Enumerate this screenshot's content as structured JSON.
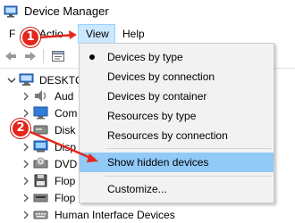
{
  "window": {
    "title": "Device Manager"
  },
  "menubar": {
    "file": "F",
    "action": "Actio",
    "view": "View",
    "help": "Help"
  },
  "tree": {
    "root": "DESKTC",
    "items": [
      {
        "label": "Aud",
        "icon": "speaker-icon"
      },
      {
        "label": "Com",
        "icon": "monitor-icon"
      },
      {
        "label": "Disk",
        "icon": "disk-drive-icon"
      },
      {
        "label": "Disp",
        "icon": "display-adapter-icon"
      },
      {
        "label": "DVD",
        "icon": "dvd-drive-icon"
      },
      {
        "label": "Flop",
        "icon": "floppy-controller-icon"
      },
      {
        "label": "Flop",
        "icon": "floppy-drive-icon"
      },
      {
        "label": "Human Interface Devices",
        "icon": "hid-icon"
      }
    ]
  },
  "view_menu": {
    "items": [
      {
        "label": "Devices by type",
        "selected": true
      },
      {
        "label": "Devices by connection",
        "selected": false
      },
      {
        "label": "Devices by container",
        "selected": false
      },
      {
        "label": "Resources by type",
        "selected": false
      },
      {
        "label": "Resources by connection",
        "selected": false
      },
      {
        "label": "Show hidden devices",
        "highlighted": true
      },
      {
        "label": "Customize..."
      }
    ]
  },
  "annotations": {
    "step1": "1",
    "step2": "2"
  },
  "colors": {
    "highlight": "#91c9f7",
    "menu_active": "#cce8ff",
    "badge": "#e5261d"
  }
}
